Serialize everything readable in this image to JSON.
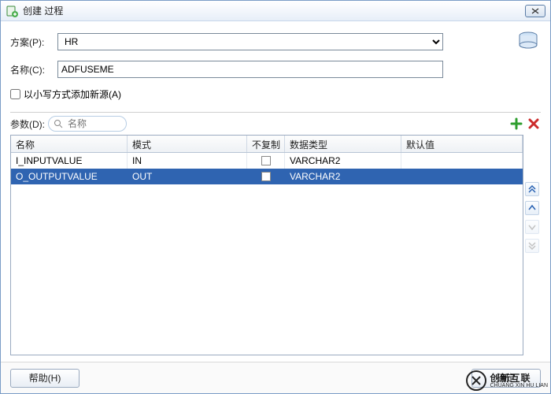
{
  "window": {
    "title": "创建 过程"
  },
  "form": {
    "scheme_label": "方案(P):",
    "scheme_value": "HR",
    "name_label": "名称(C):",
    "name_value": "ADFUSEME",
    "lowercase_label": "以小写方式添加新源(A)",
    "lowercase_checked": false
  },
  "params": {
    "label": "参数(D):",
    "search_placeholder": "名称",
    "columns": {
      "name": "名称",
      "mode": "模式",
      "nocopy": "不复制",
      "type": "数据类型",
      "default": "默认值"
    },
    "rows": [
      {
        "name": "I_INPUTVALUE",
        "mode": "IN",
        "nocopy": false,
        "type": "VARCHAR2",
        "default": "",
        "selected": false
      },
      {
        "name": "O_OUTPUTVALUE",
        "mode": "OUT",
        "nocopy": false,
        "type": "VARCHAR2",
        "default": "",
        "selected": true
      }
    ]
  },
  "footer": {
    "help": "帮助(H)",
    "ok": "确定"
  },
  "watermark": {
    "cn": "创新互联",
    "en": "CHUANG XIN HU LIAN"
  }
}
